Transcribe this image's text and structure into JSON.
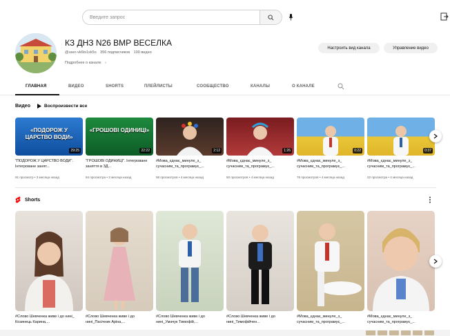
{
  "search": {
    "placeholder": "Введите запрос"
  },
  "channel": {
    "title": "КЗ ДНЗ N26 ВМР ВЕСЕЛКА",
    "handle": "@user-vk6ts1xk5o",
    "subscribers": "356 подписчиков",
    "videos_count": "100 видео",
    "about_link": "Подробнее о канале",
    "customize_label": "Настроить вид канала",
    "manage_label": "Управление видео"
  },
  "tabs": [
    {
      "label": "ГЛАВНАЯ"
    },
    {
      "label": "ВИДЕО"
    },
    {
      "label": "SHORTS"
    },
    {
      "label": "ПЛЕЙЛИСТЫ"
    },
    {
      "label": "СООБЩЕСТВО"
    },
    {
      "label": "КАНАЛЫ"
    },
    {
      "label": "О КАНАЛЕ"
    }
  ],
  "videos_section": {
    "title": "Видео",
    "play_all": "Воспроизвести все",
    "items": [
      {
        "title": "\"ПОДОРОЖ У ЦАРСТВО ВОДИ\". Інтегроване занят...",
        "meta": "91 просмотр • 3 месяца назад",
        "duration": "29:25",
        "thumb_text": "«ПОДОРОЖ У ЦАРСТВО ВОДИ»"
      },
      {
        "title": "\"ГРОШОВІ ОДИНИЦІ\". Інтегроване заняття в ЗД...",
        "meta": "64 просмотра • 3 месяца назад",
        "duration": "22:22",
        "thumb_text": "«ГРОШОВІ ОДИНИЦІ»"
      },
      {
        "title": "#Мова_єднає_минуле_з_ сучасним_та_програмує_...",
        "meta": "58 просмотров • 4 месяца назад",
        "duration": "2:12"
      },
      {
        "title": "#Мова_єднає_минуле_з_ сучасним_та_програмує_...",
        "meta": "50 просмотров • 4 месяца назад",
        "duration": "1:26"
      },
      {
        "title": "#Мова_єднає_минуле_з_ сучасним_та_програмує_...",
        "meta": "76 просмотров • 4 месяца назад",
        "duration": "0:22"
      },
      {
        "title": "#Мова_єднає_минуле_з_ сучасним_та_програмує_...",
        "meta": "22 просмотра • 4 месяца назад",
        "duration": "0:37"
      }
    ]
  },
  "shorts_section": {
    "title": "Shorts",
    "items": [
      {
        "title": "#Слово Шевченка живе і до нині_ Козинець Карина,..."
      },
      {
        "title": "#Слово Шевченка живе і до нині_Пасічник Аріна,..."
      },
      {
        "title": "#Слово Шевченка живе і до нині_Умачук Тимофій,..."
      },
      {
        "title": "#Слово Шевченка живе і до нині_Тимофійчен..."
      },
      {
        "title": "#Мова_єднає_минуле_з_ сучасним_та_програмує_..."
      },
      {
        "title": "#Мова_єднає_минуле_з_ сучасним_та_програмує_..."
      }
    ]
  },
  "colors": {
    "accent": "#0f0f0f",
    "shorts_red": "#ff0000",
    "muted": "#606060"
  }
}
